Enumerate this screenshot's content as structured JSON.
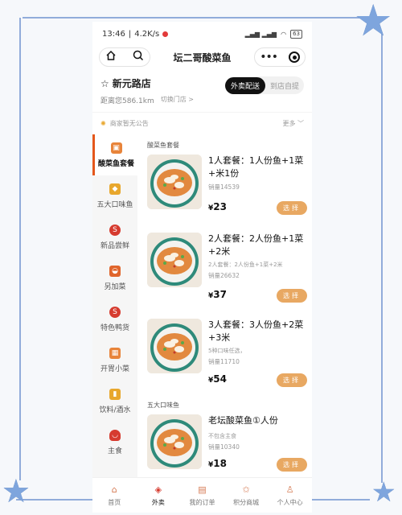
{
  "status_bar": {
    "time": "13:46",
    "speed": "4.2K/s",
    "signal": "HD 4G",
    "battery": "63"
  },
  "nav": {
    "home_icon": "home-icon",
    "search_icon": "search-icon",
    "title": "坛二哥酸菜鱼",
    "more_icon": "more-dots-icon",
    "target_icon": "target-icon"
  },
  "store": {
    "name": "新元路店",
    "distance": "距离您586.1km",
    "switch_label": "切换门店 >",
    "modes": [
      "外卖配送",
      "到店自提"
    ],
    "active_mode": "外卖配送"
  },
  "notice": {
    "text": "商家暂无公告",
    "more": "更多 ﹀"
  },
  "categories": [
    {
      "label": "酸菜鱼套餐",
      "icon": "takeout-bag-icon",
      "color": "#e8843a",
      "active": true
    },
    {
      "label": "五大口味鱼",
      "icon": "fish-icon",
      "color": "#e8a72d",
      "active": false
    },
    {
      "label": "新品尝鲜",
      "icon": "new-badge-icon",
      "color": "#d63b2f",
      "active": false
    },
    {
      "label": "另加菜",
      "icon": "dish-icon",
      "color": "#e0652c",
      "active": false
    },
    {
      "label": "特色鸭货",
      "icon": "duck-icon",
      "color": "#d63b2f",
      "active": false
    },
    {
      "label": "开胃小菜",
      "icon": "appetizer-icon",
      "color": "#e8843a",
      "active": false
    },
    {
      "label": "饮料/酒水",
      "icon": "drink-icon",
      "color": "#e8a72d",
      "active": false
    },
    {
      "label": "主食",
      "icon": "rice-bowl-icon",
      "color": "#d63b2f",
      "active": false
    }
  ],
  "sections": [
    {
      "title": "酸菜鱼套餐",
      "items": [
        {
          "name": "1人套餐：1人份鱼+1菜+米1份",
          "desc": "",
          "sales": "销量14539",
          "price_symbol": "¥",
          "price": "23",
          "button": "选择"
        },
        {
          "name": "2人套餐：2人份鱼+1菜+2米",
          "desc": "2人套餐：2人份鱼+1菜+2米",
          "sales": "销量26632",
          "price_symbol": "¥",
          "price": "37",
          "button": "选择"
        },
        {
          "name": "3人套餐：3人份鱼+2菜+3米",
          "desc": "5种口味任选，",
          "sales": "销量11710",
          "price_symbol": "¥",
          "price": "54",
          "button": "选择"
        }
      ]
    },
    {
      "title": "五大口味鱼",
      "items": [
        {
          "name": "老坛酸菜鱼①人份",
          "desc": "不包含主食",
          "sales": "销量10340",
          "price_symbol": "¥",
          "price": "18",
          "button": "选择"
        }
      ]
    }
  ],
  "tabs": [
    {
      "label": "首页",
      "icon": "home-icon",
      "active": false
    },
    {
      "label": "外卖",
      "icon": "takeout-icon",
      "active": true
    },
    {
      "label": "我的订单",
      "icon": "order-icon",
      "active": false
    },
    {
      "label": "积分商城",
      "icon": "points-mall-icon",
      "active": false
    },
    {
      "label": "个人中心",
      "icon": "profile-icon",
      "active": false
    }
  ]
}
